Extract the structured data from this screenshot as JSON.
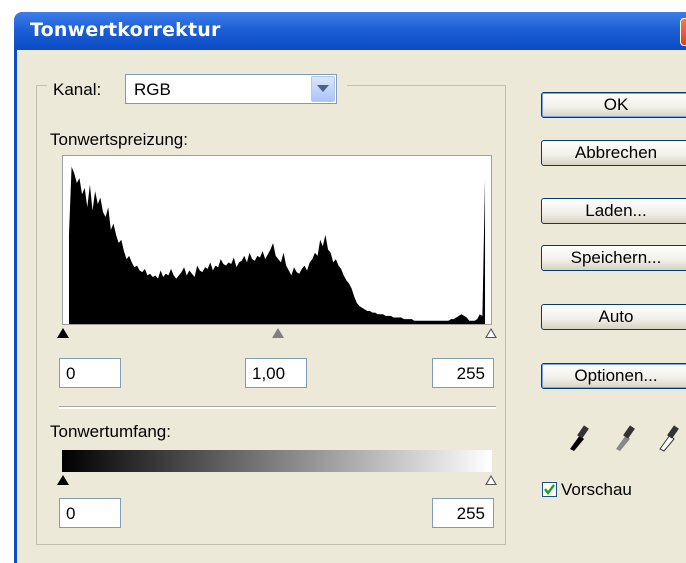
{
  "window": {
    "title": "Tonwertkorrektur",
    "close_glyph": "✕"
  },
  "channel": {
    "label": "Kanal:",
    "value": "RGB"
  },
  "input_levels": {
    "label": "Tonwertspreizung:",
    "black": "0",
    "gamma": "1,00",
    "white": "255"
  },
  "output_levels": {
    "label": "Tonwertumfang:",
    "black": "0",
    "white": "255"
  },
  "buttons": {
    "ok": "OK",
    "cancel": "Abbrechen",
    "load": "Laden...",
    "save": "Speichern...",
    "auto": "Auto",
    "options": "Optionen..."
  },
  "preview": {
    "label": "Vorschau",
    "checked": true
  },
  "icons": [
    "black-eyedropper-icon",
    "gray-eyedropper-icon",
    "white-eyedropper-icon"
  ],
  "colors": {
    "title_bar": "#0b4cc4",
    "dialog_bg": "#ece9d8"
  },
  "histogram": [
    0.55,
    0.97,
    0.93,
    0.87,
    0.9,
    0.8,
    0.84,
    0.72,
    0.86,
    0.7,
    0.82,
    0.74,
    0.78,
    0.69,
    0.66,
    0.72,
    0.58,
    0.62,
    0.55,
    0.5,
    0.52,
    0.45,
    0.4,
    0.42,
    0.38,
    0.35,
    0.36,
    0.33,
    0.32,
    0.34,
    0.3,
    0.31,
    0.29,
    0.3,
    0.28,
    0.33,
    0.29,
    0.31,
    0.3,
    0.34,
    0.3,
    0.28,
    0.3,
    0.32,
    0.35,
    0.3,
    0.33,
    0.31,
    0.29,
    0.36,
    0.33,
    0.32,
    0.35,
    0.34,
    0.38,
    0.33,
    0.36,
    0.35,
    0.4,
    0.37,
    0.36,
    0.38,
    0.37,
    0.41,
    0.35,
    0.38,
    0.39,
    0.42,
    0.38,
    0.44,
    0.4,
    0.39,
    0.42,
    0.41,
    0.45,
    0.4,
    0.43,
    0.46,
    0.5,
    0.42,
    0.4,
    0.38,
    0.44,
    0.36,
    0.33,
    0.3,
    0.35,
    0.32,
    0.31,
    0.34,
    0.36,
    0.33,
    0.38,
    0.4,
    0.44,
    0.42,
    0.52,
    0.48,
    0.55,
    0.46,
    0.44,
    0.38,
    0.4,
    0.36,
    0.34,
    0.3,
    0.27,
    0.25,
    0.22,
    0.17,
    0.13,
    0.11,
    0.1,
    0.09,
    0.08,
    0.08,
    0.07,
    0.07,
    0.06,
    0.06,
    0.06,
    0.05,
    0.05,
    0.05,
    0.04,
    0.04,
    0.04,
    0.04,
    0.03,
    0.03,
    0.03,
    0.03,
    0.02,
    0.02,
    0.02,
    0.02,
    0.02,
    0.02,
    0.02,
    0.02,
    0.02,
    0.02,
    0.02,
    0.02,
    0.02,
    0.02,
    0.03,
    0.03,
    0.04,
    0.05,
    0.06,
    0.05,
    0.04,
    0.02,
    0.02,
    0.02,
    0.03,
    0.06,
    0.05,
    0.9
  ]
}
